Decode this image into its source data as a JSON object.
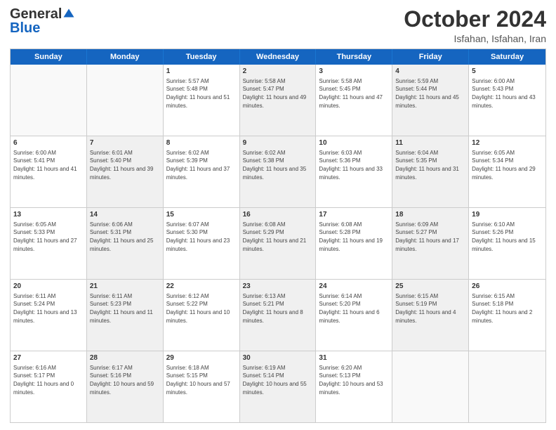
{
  "logo": {
    "general": "General",
    "blue": "Blue"
  },
  "title": "October 2024",
  "location": "Isfahan, Isfahan, Iran",
  "days": [
    "Sunday",
    "Monday",
    "Tuesday",
    "Wednesday",
    "Thursday",
    "Friday",
    "Saturday"
  ],
  "weeks": [
    [
      {
        "day": "",
        "sunrise": "",
        "sunset": "",
        "daylight": "",
        "shaded": false,
        "empty": true
      },
      {
        "day": "",
        "sunrise": "",
        "sunset": "",
        "daylight": "",
        "shaded": false,
        "empty": true
      },
      {
        "day": "1",
        "sunrise": "Sunrise: 5:57 AM",
        "sunset": "Sunset: 5:48 PM",
        "daylight": "Daylight: 11 hours and 51 minutes.",
        "shaded": false,
        "empty": false
      },
      {
        "day": "2",
        "sunrise": "Sunrise: 5:58 AM",
        "sunset": "Sunset: 5:47 PM",
        "daylight": "Daylight: 11 hours and 49 minutes.",
        "shaded": true,
        "empty": false
      },
      {
        "day": "3",
        "sunrise": "Sunrise: 5:58 AM",
        "sunset": "Sunset: 5:45 PM",
        "daylight": "Daylight: 11 hours and 47 minutes.",
        "shaded": false,
        "empty": false
      },
      {
        "day": "4",
        "sunrise": "Sunrise: 5:59 AM",
        "sunset": "Sunset: 5:44 PM",
        "daylight": "Daylight: 11 hours and 45 minutes.",
        "shaded": true,
        "empty": false
      },
      {
        "day": "5",
        "sunrise": "Sunrise: 6:00 AM",
        "sunset": "Sunset: 5:43 PM",
        "daylight": "Daylight: 11 hours and 43 minutes.",
        "shaded": false,
        "empty": false
      }
    ],
    [
      {
        "day": "6",
        "sunrise": "Sunrise: 6:00 AM",
        "sunset": "Sunset: 5:41 PM",
        "daylight": "Daylight: 11 hours and 41 minutes.",
        "shaded": false,
        "empty": false
      },
      {
        "day": "7",
        "sunrise": "Sunrise: 6:01 AM",
        "sunset": "Sunset: 5:40 PM",
        "daylight": "Daylight: 11 hours and 39 minutes.",
        "shaded": true,
        "empty": false
      },
      {
        "day": "8",
        "sunrise": "Sunrise: 6:02 AM",
        "sunset": "Sunset: 5:39 PM",
        "daylight": "Daylight: 11 hours and 37 minutes.",
        "shaded": false,
        "empty": false
      },
      {
        "day": "9",
        "sunrise": "Sunrise: 6:02 AM",
        "sunset": "Sunset: 5:38 PM",
        "daylight": "Daylight: 11 hours and 35 minutes.",
        "shaded": true,
        "empty": false
      },
      {
        "day": "10",
        "sunrise": "Sunrise: 6:03 AM",
        "sunset": "Sunset: 5:36 PM",
        "daylight": "Daylight: 11 hours and 33 minutes.",
        "shaded": false,
        "empty": false
      },
      {
        "day": "11",
        "sunrise": "Sunrise: 6:04 AM",
        "sunset": "Sunset: 5:35 PM",
        "daylight": "Daylight: 11 hours and 31 minutes.",
        "shaded": true,
        "empty": false
      },
      {
        "day": "12",
        "sunrise": "Sunrise: 6:05 AM",
        "sunset": "Sunset: 5:34 PM",
        "daylight": "Daylight: 11 hours and 29 minutes.",
        "shaded": false,
        "empty": false
      }
    ],
    [
      {
        "day": "13",
        "sunrise": "Sunrise: 6:05 AM",
        "sunset": "Sunset: 5:33 PM",
        "daylight": "Daylight: 11 hours and 27 minutes.",
        "shaded": false,
        "empty": false
      },
      {
        "day": "14",
        "sunrise": "Sunrise: 6:06 AM",
        "sunset": "Sunset: 5:31 PM",
        "daylight": "Daylight: 11 hours and 25 minutes.",
        "shaded": true,
        "empty": false
      },
      {
        "day": "15",
        "sunrise": "Sunrise: 6:07 AM",
        "sunset": "Sunset: 5:30 PM",
        "daylight": "Daylight: 11 hours and 23 minutes.",
        "shaded": false,
        "empty": false
      },
      {
        "day": "16",
        "sunrise": "Sunrise: 6:08 AM",
        "sunset": "Sunset: 5:29 PM",
        "daylight": "Daylight: 11 hours and 21 minutes.",
        "shaded": true,
        "empty": false
      },
      {
        "day": "17",
        "sunrise": "Sunrise: 6:08 AM",
        "sunset": "Sunset: 5:28 PM",
        "daylight": "Daylight: 11 hours and 19 minutes.",
        "shaded": false,
        "empty": false
      },
      {
        "day": "18",
        "sunrise": "Sunrise: 6:09 AM",
        "sunset": "Sunset: 5:27 PM",
        "daylight": "Daylight: 11 hours and 17 minutes.",
        "shaded": true,
        "empty": false
      },
      {
        "day": "19",
        "sunrise": "Sunrise: 6:10 AM",
        "sunset": "Sunset: 5:26 PM",
        "daylight": "Daylight: 11 hours and 15 minutes.",
        "shaded": false,
        "empty": false
      }
    ],
    [
      {
        "day": "20",
        "sunrise": "Sunrise: 6:11 AM",
        "sunset": "Sunset: 5:24 PM",
        "daylight": "Daylight: 11 hours and 13 minutes.",
        "shaded": false,
        "empty": false
      },
      {
        "day": "21",
        "sunrise": "Sunrise: 6:11 AM",
        "sunset": "Sunset: 5:23 PM",
        "daylight": "Daylight: 11 hours and 11 minutes.",
        "shaded": true,
        "empty": false
      },
      {
        "day": "22",
        "sunrise": "Sunrise: 6:12 AM",
        "sunset": "Sunset: 5:22 PM",
        "daylight": "Daylight: 11 hours and 10 minutes.",
        "shaded": false,
        "empty": false
      },
      {
        "day": "23",
        "sunrise": "Sunrise: 6:13 AM",
        "sunset": "Sunset: 5:21 PM",
        "daylight": "Daylight: 11 hours and 8 minutes.",
        "shaded": true,
        "empty": false
      },
      {
        "day": "24",
        "sunrise": "Sunrise: 6:14 AM",
        "sunset": "Sunset: 5:20 PM",
        "daylight": "Daylight: 11 hours and 6 minutes.",
        "shaded": false,
        "empty": false
      },
      {
        "day": "25",
        "sunrise": "Sunrise: 6:15 AM",
        "sunset": "Sunset: 5:19 PM",
        "daylight": "Daylight: 11 hours and 4 minutes.",
        "shaded": true,
        "empty": false
      },
      {
        "day": "26",
        "sunrise": "Sunrise: 6:15 AM",
        "sunset": "Sunset: 5:18 PM",
        "daylight": "Daylight: 11 hours and 2 minutes.",
        "shaded": false,
        "empty": false
      }
    ],
    [
      {
        "day": "27",
        "sunrise": "Sunrise: 6:16 AM",
        "sunset": "Sunset: 5:17 PM",
        "daylight": "Daylight: 11 hours and 0 minutes.",
        "shaded": false,
        "empty": false
      },
      {
        "day": "28",
        "sunrise": "Sunrise: 6:17 AM",
        "sunset": "Sunset: 5:16 PM",
        "daylight": "Daylight: 10 hours and 59 minutes.",
        "shaded": true,
        "empty": false
      },
      {
        "day": "29",
        "sunrise": "Sunrise: 6:18 AM",
        "sunset": "Sunset: 5:15 PM",
        "daylight": "Daylight: 10 hours and 57 minutes.",
        "shaded": false,
        "empty": false
      },
      {
        "day": "30",
        "sunrise": "Sunrise: 6:19 AM",
        "sunset": "Sunset: 5:14 PM",
        "daylight": "Daylight: 10 hours and 55 minutes.",
        "shaded": true,
        "empty": false
      },
      {
        "day": "31",
        "sunrise": "Sunrise: 6:20 AM",
        "sunset": "Sunset: 5:13 PM",
        "daylight": "Daylight: 10 hours and 53 minutes.",
        "shaded": false,
        "empty": false
      },
      {
        "day": "",
        "sunrise": "",
        "sunset": "",
        "daylight": "",
        "shaded": true,
        "empty": true
      },
      {
        "day": "",
        "sunrise": "",
        "sunset": "",
        "daylight": "",
        "shaded": false,
        "empty": true
      }
    ]
  ]
}
